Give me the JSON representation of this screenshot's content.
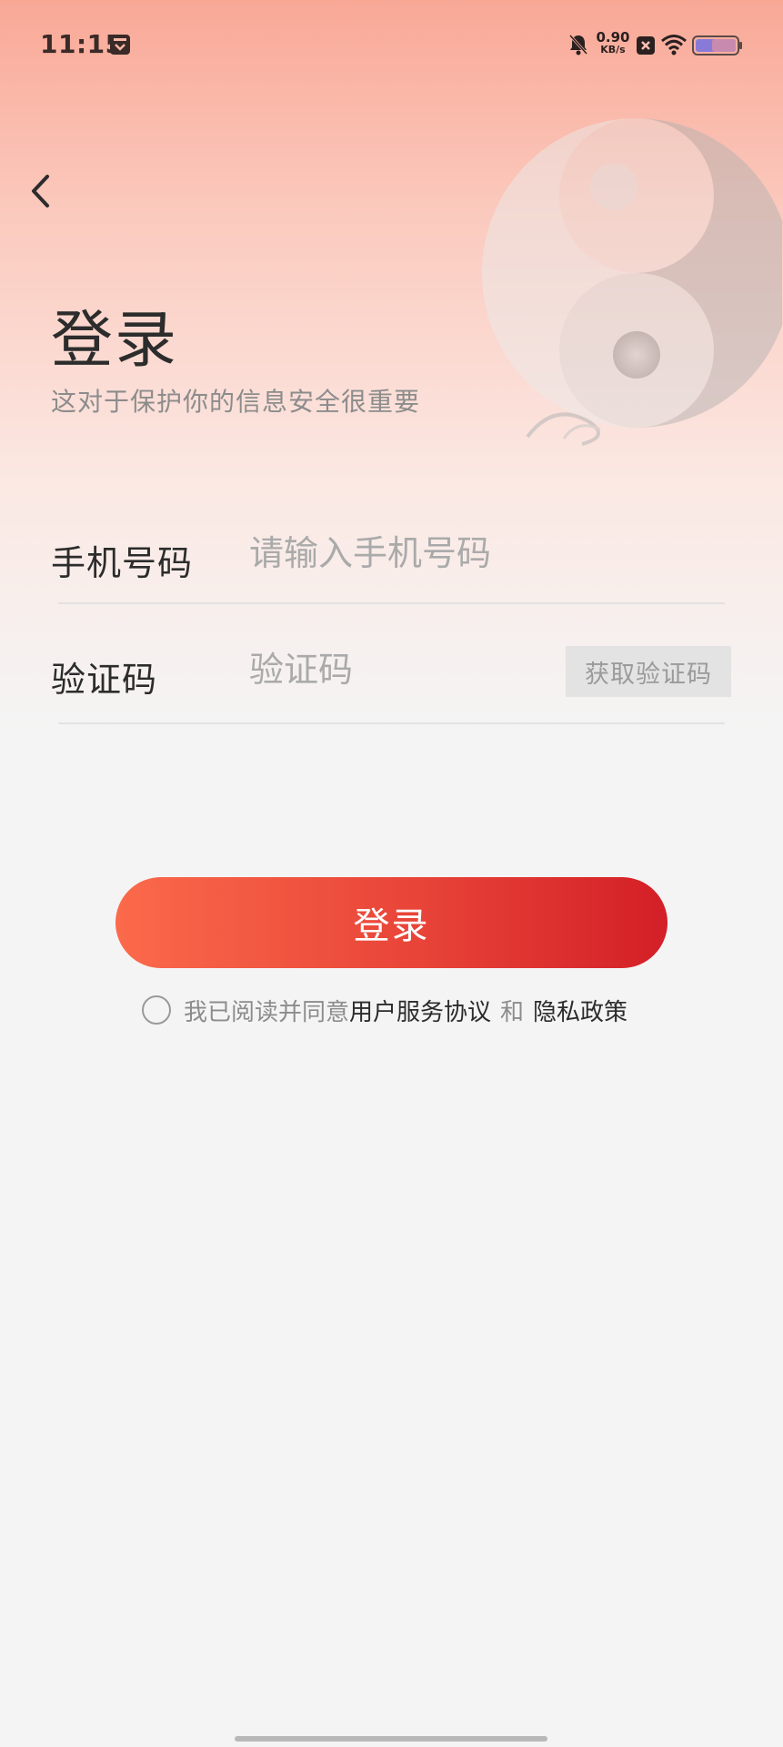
{
  "status_bar": {
    "time": "11:15",
    "net_speed_value": "0.90",
    "net_speed_unit": "KB/s",
    "icons": [
      "calendar-icon",
      "bell-muted-icon",
      "x-icon",
      "wifi-icon",
      "battery-icon"
    ]
  },
  "header": {
    "back_icon": "chevron-left-icon",
    "title": "登录",
    "subtitle": "这对于保护你的信息安全很重要"
  },
  "form": {
    "phone": {
      "label": "手机号码",
      "placeholder": "请输入手机号码",
      "value": ""
    },
    "code": {
      "label": "验证码",
      "placeholder": "验证码",
      "value": "",
      "get_code_label": "获取验证码"
    },
    "submit_label": "登录"
  },
  "agreement": {
    "checked": false,
    "prefix": "我已阅读并同意",
    "terms_label": "用户服务协议",
    "and_label": "和",
    "privacy_label": "隐私政策"
  },
  "colors": {
    "accent_start": "#fb6a4b",
    "accent_end": "#d31f27",
    "background": "#f4f4f4"
  }
}
